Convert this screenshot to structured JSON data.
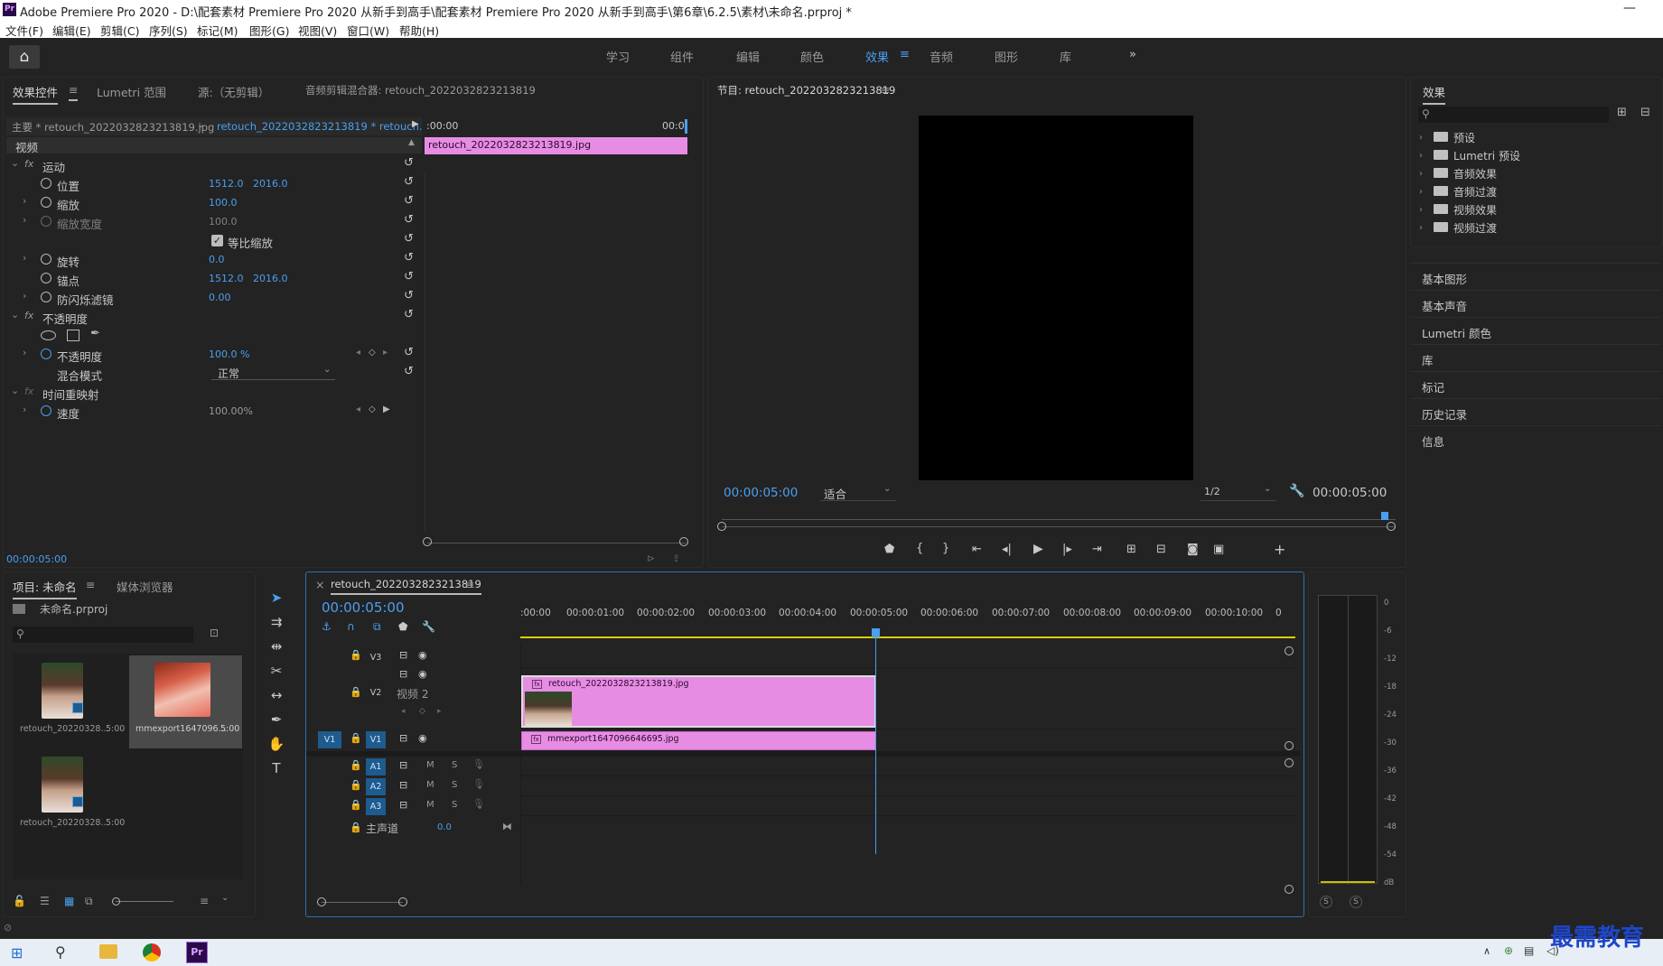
{
  "window": {
    "app_icon": "Pr",
    "title": "Adobe Premiere Pro 2020 - D:\\配套素材 Premiere Pro 2020 从新手到高手\\配套素材 Premiere Pro 2020 从新手到高手\\第6章\\6.2.5\\素材\\未命名.prproj *",
    "minimize": "—"
  },
  "menu": [
    "文件(F)",
    "编辑(E)",
    "剪辑(C)",
    "序列(S)",
    "标记(M)",
    "图形(G)",
    "视图(V)",
    "窗口(W)",
    "帮助(H)"
  ],
  "workspaces": {
    "tabs": [
      "学习",
      "组件",
      "编辑",
      "颜色",
      "效果",
      "音频",
      "图形",
      "库"
    ],
    "active": "效果",
    "more": "»",
    "menu_icon": "≡"
  },
  "effect_controls": {
    "tabs": [
      "效果控件",
      "Lumetri 范围",
      "源:（无剪辑）",
      "音频剪辑混合器: retouch_2022032823213819"
    ],
    "menu_icon": "≡",
    "master": "主要 * retouch_2022032823213819.jpg",
    "sequence_clip": "retouch_2022032823213819 * retouch...",
    "section_video": "视频",
    "ruler_start": ":00:00",
    "ruler_end": "00:0",
    "clip_bar_label": "retouch_2022032823213819.jpg",
    "current_time": "00:00:05:00",
    "fx_label": "fx",
    "rows": {
      "motion": "运动",
      "position": {
        "label": "位置",
        "x": "1512.0",
        "y": "2016.0"
      },
      "scale": {
        "label": "缩放",
        "value": "100.0"
      },
      "scale_width": {
        "label": "缩放宽度",
        "value": "100.0"
      },
      "uniform_scale": "等比缩放",
      "rotation": {
        "label": "旋转",
        "value": "0.0"
      },
      "anchor": {
        "label": "锚点",
        "x": "1512.0",
        "y": "2016.0"
      },
      "anti_flicker": {
        "label": "防闪烁滤镜",
        "value": "0.00"
      },
      "opacity_group": "不透明度",
      "opacity": {
        "label": "不透明度",
        "value": "100.0 %"
      },
      "blend_mode": {
        "label": "混合模式",
        "value": "正常"
      },
      "time_remap": "时间重映射",
      "speed": {
        "label": "速度",
        "value": "100.00%"
      }
    }
  },
  "program_monitor": {
    "title": "节目: retouch_2022032823213819",
    "menu_icon": "≡",
    "timecode_left": "00:00:05:00",
    "fit": "适合",
    "resolution": "1/2",
    "timecode_right": "00:00:05:00"
  },
  "effects_panel": {
    "title": "效果",
    "items": [
      "预设",
      "Lumetri 预设",
      "音频效果",
      "音频过渡",
      "视频效果",
      "视频过渡"
    ],
    "sections": [
      "基本图形",
      "基本声音",
      "Lumetri 颜色",
      "库",
      "标记",
      "历史记录",
      "信息"
    ]
  },
  "project": {
    "tabs": [
      "项目: 未命名",
      "媒体浏览器"
    ],
    "menu_icon": "≡",
    "file": "未命名.prproj",
    "items": [
      {
        "name": "retouch_20220328...",
        "duration": "5:00"
      },
      {
        "name": "mmexport1647096...",
        "duration": "5:00"
      },
      {
        "name": "retouch_20220328...",
        "duration": "5:00"
      }
    ]
  },
  "timeline": {
    "title": "retouch_2022032823213819",
    "menu_icon": "≡",
    "close": "×",
    "timecode": "00:00:05:00",
    "ruler": [
      ":00:00",
      "00:00:01:00",
      "00:00:02:00",
      "00:00:03:00",
      "00:00:04:00",
      "00:00:05:00",
      "00:00:06:00",
      "00:00:07:00",
      "00:00:08:00",
      "00:00:09:00",
      "00:00:10:00",
      "0"
    ],
    "tracks": {
      "v3": "V3",
      "v2": "V2",
      "v2_name": "视频 2",
      "v1_src": "V1",
      "v1": "V1",
      "a1": "A1",
      "a2": "A2",
      "a3": "A3",
      "mute": "M",
      "solo": "S",
      "master": "主声道",
      "master_value": "0.0"
    },
    "clips": {
      "v2": "retouch_2022032823213819.jpg",
      "v1": "mmexport1647096646695.jpg"
    }
  },
  "meter": {
    "labels": [
      "0",
      "-6",
      "-12",
      "-18",
      "-24",
      "-30",
      "-36",
      "-42",
      "-48",
      "-54",
      "dB"
    ],
    "solo": [
      "S",
      "S"
    ]
  },
  "watermark": "最需教育",
  "colors": {
    "accent": "#4a9ff0",
    "clip": "#e78ce3",
    "track_btn": "#1e5b8f"
  }
}
